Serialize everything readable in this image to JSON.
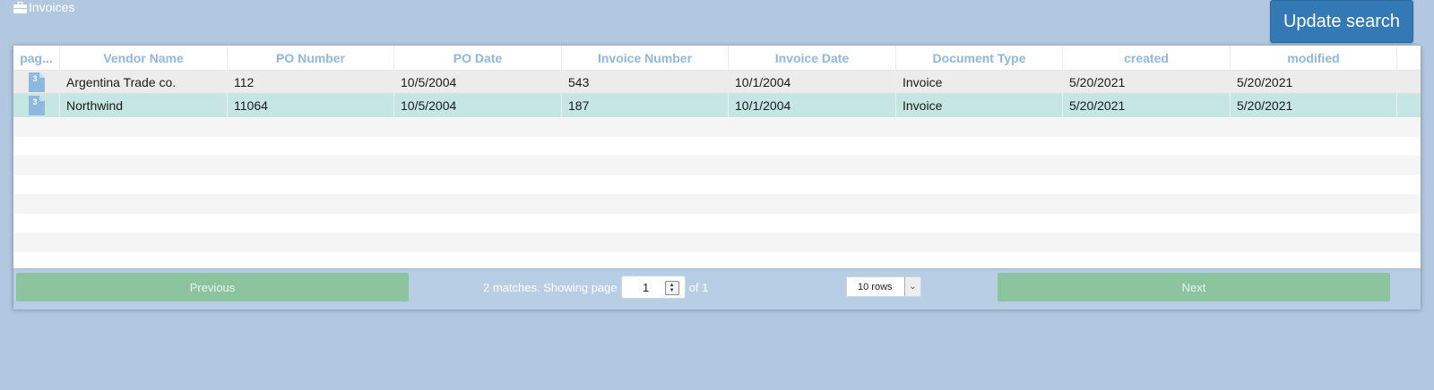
{
  "header": {
    "title": "Invoices",
    "update_button": "Update search"
  },
  "table": {
    "columns": [
      "pag...",
      "Vendor Name",
      "PO Number",
      "PO Date",
      "Invoice Number",
      "Invoice Date",
      "Document Type",
      "created",
      "modified"
    ],
    "rows": [
      {
        "page_icon_num": "3",
        "vendor": "Argentina Trade co.",
        "po_number": "112",
        "po_date": "10/5/2004",
        "invoice_number": "543",
        "invoice_date": "10/1/2004",
        "doc_type": "Invoice",
        "created": "5/20/2021",
        "modified": "5/20/2021"
      },
      {
        "page_icon_num": "3",
        "vendor": "Northwind",
        "po_number": "11064",
        "po_date": "10/5/2004",
        "invoice_number": "187",
        "invoice_date": "10/1/2004",
        "doc_type": "Invoice",
        "created": "5/20/2021",
        "modified": "5/20/2021"
      }
    ]
  },
  "pagination": {
    "previous": "Previous",
    "next": "Next",
    "matches_text": "2 matches. Showing page",
    "page": "1",
    "of_text": "of 1",
    "rows_option": "10 rows"
  },
  "colors": {
    "background": "#b1c8e0",
    "accent": "#3279b6",
    "nav_button": "#8bc49f",
    "selected_row": "#c6e6e4",
    "header_text": "#8fb8de"
  },
  "icons": {
    "title": "briefcase-icon",
    "row": "document-icon",
    "select": "chevron-down-icon"
  }
}
